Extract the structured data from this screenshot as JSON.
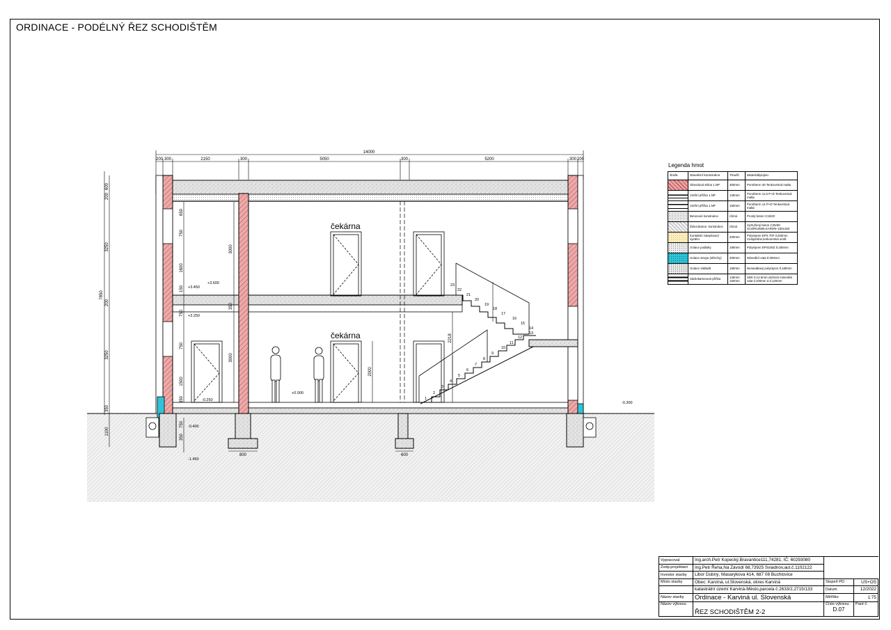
{
  "sheet_title": "ORDINACE - PODÉLNÝ ŘEZ SCHODIŠTĚM",
  "drawing": {
    "room_labels": [
      "čekárna",
      "čekárna"
    ],
    "top_dimensions": [
      "14000",
      "200",
      "300",
      "2150",
      "300",
      "5050",
      "300",
      "5200",
      "300",
      "200"
    ],
    "left_dimensions": [
      "7850",
      "3250",
      "3250",
      "600",
      "200",
      "200",
      "350",
      "1100",
      "650",
      "750",
      "1600",
      "150",
      "750",
      "750",
      "1500",
      "350",
      "3000",
      "3000",
      "350",
      "750",
      "350"
    ],
    "bottom_dimensions": [
      "800",
      "600"
    ],
    "door_dimensions": [
      "2000",
      "2218"
    ],
    "level_marks": [
      "+3.600",
      "+3.450",
      "+3.250",
      "+0.000",
      "-0.250",
      "-0.300",
      "-0.400",
      "-1.450"
    ],
    "stair_numbers": [
      "1",
      "2",
      "3",
      "4",
      "5",
      "6",
      "7",
      "8",
      "9",
      "10",
      "11",
      "12",
      "13",
      "14",
      "15",
      "16",
      "17",
      "18",
      "19",
      "20",
      "21",
      "22",
      "23"
    ]
  },
  "legend": {
    "title": "Legenda hmot",
    "headers": [
      "Šrafa",
      "Stavební konstrukce",
      "Tloušť.",
      "Materiál/pojivo"
    ],
    "rows": [
      {
        "name": "Obvodová stěna 1.NP",
        "thickness": "300mm",
        "material": "Porotherm 30 Tenkovrstvá malta",
        "color": "#e9a3a3"
      },
      {
        "name": "Vnitřní příčka 1.NP",
        "thickness": "125mm",
        "material": "Porotherm 11,5 P+D Tenkovrstvá malta",
        "color": "#ffffff"
      },
      {
        "name": "Vnitřní příčka 1.NP",
        "thickness": "150mm",
        "material": "Porotherm 14 P+D Tenkovrstvá malta",
        "color": "#ffffff"
      },
      {
        "name": "Betonové konstrukce",
        "thickness": "různá",
        "material": "Prostý beton C15/20",
        "color": "#e6e6e6"
      },
      {
        "name": "Železobeton. konstrukce",
        "thickness": "různá",
        "material": "Vyztužený beton C25/30 Ocel/R10505,KARI#6–150x150",
        "color": "#f2f2f2"
      },
      {
        "name": "Kontaktní zateplovací systém",
        "thickness": "200mm",
        "material": "Polystyren EPS 70F tl.200mm Celoplošné,tenkovrstvá omítl.",
        "color": "#fbeec0"
      },
      {
        "name": "Izolace podlahy",
        "thickness": "180mm",
        "material": "Polystyren EPS100Z tl.180mm",
        "color": "#eeeeee"
      },
      {
        "name": "Izolace stropu (střechy)",
        "thickness": "300mm",
        "material": "Minerální vata tl.300mm",
        "color": "#2ec4d8"
      },
      {
        "name": "Izolace základů",
        "thickness": "180mm",
        "material": "Nenasákavý polystyren tl.180mm",
        "color": "#e9e9e9"
      },
      {
        "name": "Sádrokartonová příčka",
        "thickness": "125mm 150mm",
        "material": "SDK tl.12.5mm,vložená minerální vata tl.100mm a tl.120mm",
        "color": "#ffffff"
      }
    ]
  },
  "title_block": {
    "vypracoval_label": "Vypracoval",
    "vypracoval": "Ing.arch.Petr Kopecký,Bravantice111,74281, IČ: 60293080",
    "projektant_label": "Zodp.projektant",
    "projektant": "Ing.Petr Řeha,Na Závodí 68,73925 Sviadnov,aut.č.1102122",
    "investor_label": "Investor stavby",
    "investor": "Libor Dubný, Masarykova 414, 687 08 Buchlovice",
    "misto_label": "Místo stavby",
    "misto1": "Obec: Karviná, ul.Slovenská, okres Karviná",
    "misto2": "katastrální území Karviná-Město,parcela č.2633/2,2715/133",
    "nazev_stavby_label": "Název stavby",
    "nazev_stavby": "Ordinace - Karviná ul. Slovenská",
    "nazev_vykresu_label": "Název výkresu",
    "nazev_vykresu": "ŘEZ SCHODIŠTĚM 2-2",
    "stupen_label": "Stupeň PD",
    "stupen": "US+OS",
    "datum_label": "Datum",
    "datum": "12/2022",
    "meritko_label": "Měřítko",
    "meritko": "1:75",
    "cislo_label": "Číslo výkresu",
    "cislo": "D.07",
    "pare_label": "Paré č."
  }
}
